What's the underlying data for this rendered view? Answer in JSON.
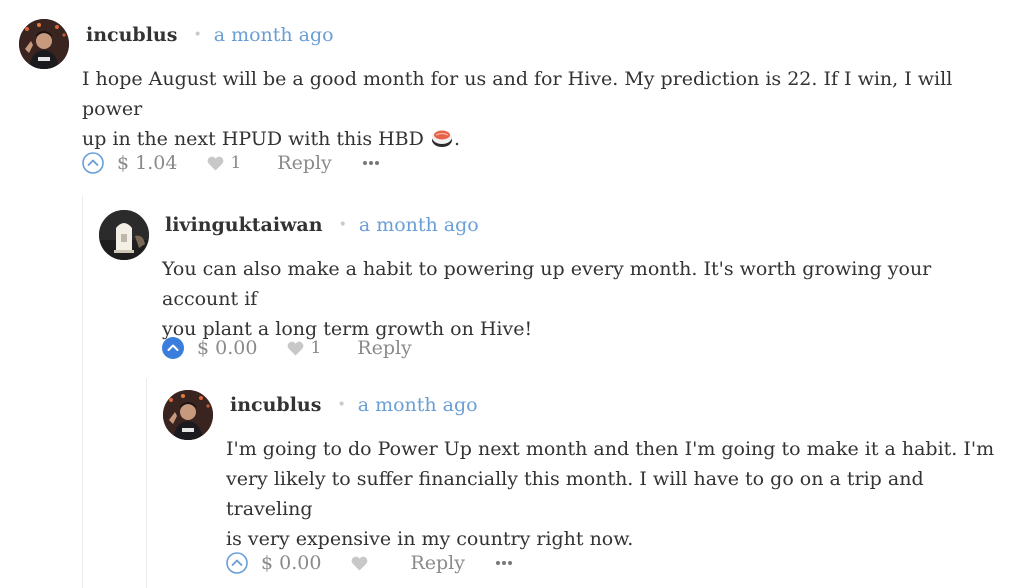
{
  "comments": [
    {
      "author": "incublus",
      "time": "a month ago",
      "body_lines": [
        "I hope August will be a good month for us and for Hive. My prediction is 22. If I win, I will power",
        "up in the next HPUD with this HBD"
      ],
      "body_suffix": ".",
      "emoji": "sushi",
      "payout": "$ 1.04",
      "likes": "1",
      "reply_label": "Reply",
      "voted": false,
      "has_more": true
    },
    {
      "author": "livinguktaiwan",
      "time": "a month ago",
      "body_lines": [
        "You can also make a habit to powering up every month. It's worth growing your account if",
        "you plant a long term growth on Hive!"
      ],
      "payout": "$ 0.00",
      "likes": "1",
      "reply_label": "Reply",
      "voted": true,
      "has_more": false
    },
    {
      "author": "incublus",
      "time": "a month ago",
      "body_lines": [
        "I'm going to do Power Up next month and then I'm going to make it a habit. I'm",
        "very likely to suffer financially this month. I will have to go on a trip and traveling",
        "is very expensive in my country right now."
      ],
      "payout": "$ 0.00",
      "likes": "",
      "reply_label": "Reply",
      "voted": false,
      "has_more": true
    }
  ],
  "colors": {
    "accent": "#6a9ed6",
    "voted": "#3b7ddd",
    "muted": "#8a8a8a",
    "text": "#333333"
  },
  "icons": [
    "upvote-icon",
    "heart-icon",
    "more-dots-icon",
    "avatar"
  ]
}
